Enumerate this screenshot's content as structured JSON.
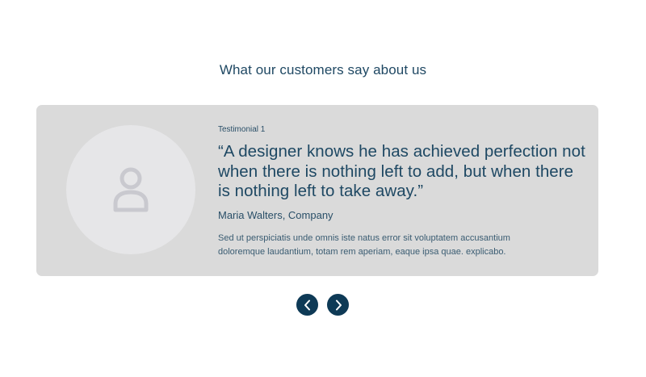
{
  "section": {
    "title": "What our customers say about us"
  },
  "testimonial": {
    "label": "Testimonial 1",
    "quote": "“A designer knows he has achieved perfection not when there is nothing left to add, but when there is nothing left to take away.”",
    "author": "Maria Walters, Company",
    "description": "Sed ut perspiciatis unde omnis iste natus error sit voluptatem accusantium doloremque laudantium, totam rem aperiam, eaque ipsa quae. explicabo.",
    "avatar_icon": "user-icon"
  },
  "navigation": {
    "prev_icon": "chevron-left-icon",
    "next_icon": "chevron-right-icon"
  },
  "colors": {
    "card_background": "#dadada",
    "avatar_background": "#e6e6e8",
    "button_background": "#0e3a56",
    "text_primary": "#1e4863"
  }
}
